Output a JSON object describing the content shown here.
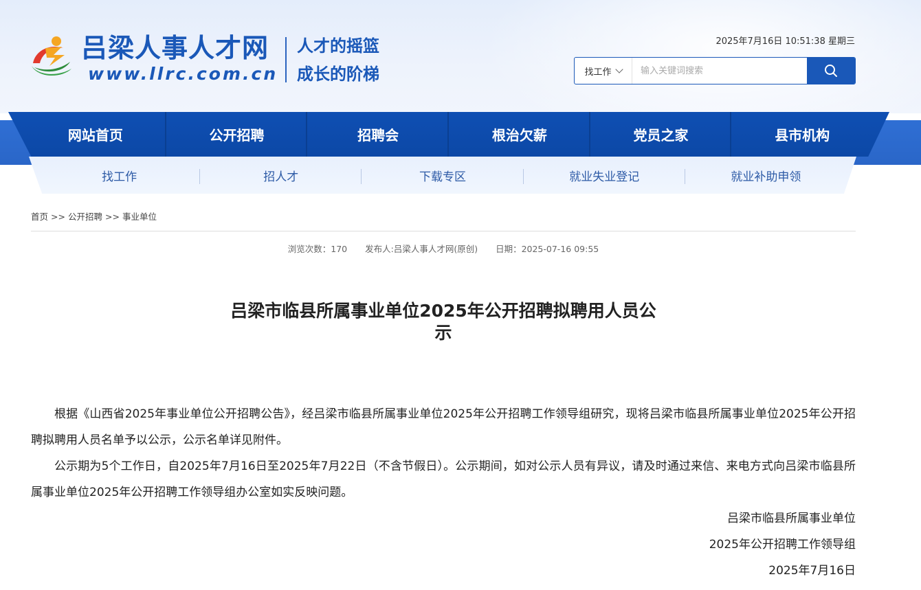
{
  "header": {
    "site_name": "吕梁人事人才网",
    "site_url": "www.llrc.com.cn",
    "slogan_line1": "人才的摇篮",
    "slogan_line2": "成长的阶梯",
    "datetime": "2025年7月16日 10:51:38 星期三",
    "colors": {
      "brand_blue": "#1a58b8",
      "logo_orange": "#f5a623",
      "logo_green": "#3aa24a",
      "logo_red": "#e23a2e"
    }
  },
  "search": {
    "category": "找工作",
    "placeholder": "输入关键词搜索",
    "button_icon": "search-icon"
  },
  "nav": {
    "items": [
      {
        "label": "网站首页"
      },
      {
        "label": "公开招聘"
      },
      {
        "label": "招聘会"
      },
      {
        "label": "根治欠薪"
      },
      {
        "label": "党员之家"
      },
      {
        "label": "县市机构"
      }
    ]
  },
  "subnav": {
    "items": [
      {
        "label": "找工作"
      },
      {
        "label": "招人才"
      },
      {
        "label": "下载专区"
      },
      {
        "label": "就业失业登记"
      },
      {
        "label": "就业补助申领"
      }
    ]
  },
  "breadcrumb": {
    "items": [
      "首页",
      "公开招聘",
      "事业单位"
    ],
    "separator": ">>"
  },
  "article": {
    "views": "浏览次数：170",
    "publisher": "发布人:吕梁人事人才网(原创)",
    "date": "日期：2025-07-16 09:55",
    "title": "吕梁市临县所属事业单位2025年公开招聘拟聘用人员公示",
    "paragraphs": [
      "根据《山西省2025年事业单位公开招聘公告》，经吕梁市临县所属事业单位2025年公开招聘工作领导组研究，现将吕梁市临县所属事业单位2025年公开招聘拟聘用人员名单予以公示，公示名单详见附件。",
      "公示期为5个工作日，自2025年7月16日至2025年7月22日（不含节假日）。公示期间，如对公示人员有异议，请及时通过来信、来电方式向吕梁市临县所属事业单位2025年公开招聘工作领导组办公室如实反映问题。"
    ],
    "signature": {
      "org": "吕梁市临县所属事业单位",
      "group": "2025年公开招聘工作领导组",
      "date": "2025年7月16日"
    }
  }
}
